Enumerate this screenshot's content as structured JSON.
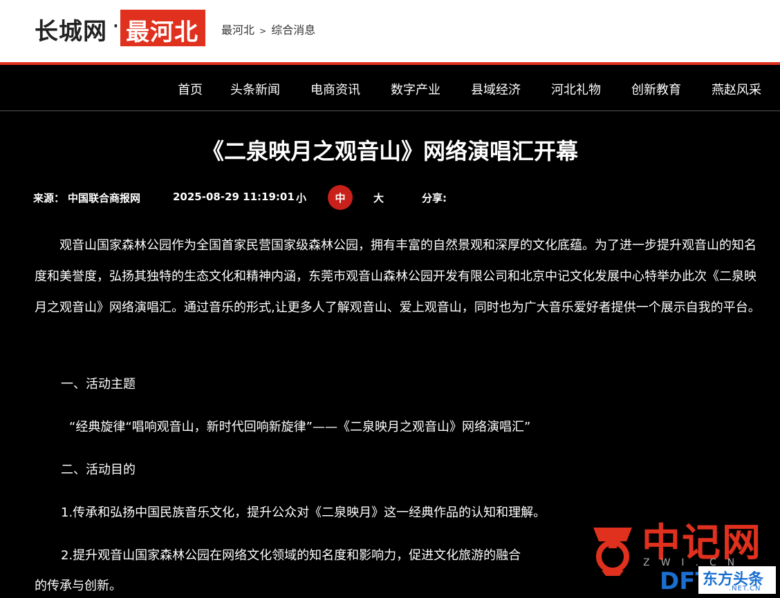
{
  "header": {
    "logo_main": "长城网",
    "logo_dot": "·",
    "logo_sub": "最河北",
    "breadcrumb": [
      "最河北",
      ">",
      "综合消息"
    ]
  },
  "nav": {
    "items": [
      "首页",
      "头条新闻",
      "电商资讯",
      "数字产业",
      "县域经济",
      "河北礼物",
      "创新教育",
      "燕赵风采"
    ]
  },
  "article": {
    "title": "《二泉映月之观音山》网络演唱汇开幕",
    "meta": {
      "source_label": "来源：",
      "source": "中国联合商报网",
      "datetime": "2025-08-29 11:19:01",
      "size_small": "小",
      "size_mid": "中",
      "size_large": "大",
      "share_label": "分享:"
    },
    "intro": "观音山国家森林公园作为全国首家民营国家级森林公园，拥有丰富的自然景观和深厚的文化底蕴。为了进一步提升观音山的知名度和美誉度，弘扬其独特的生态文化和精神内涵，东莞市观音山森林公园开发有限公司和北京中记文化发展中心特举办此次《二泉映月之观音山》网络演唱汇。通过音乐的形式,让更多人了解观音山、爱上观音山，同时也为广大音乐爱好者提供一个展示自我的平台。",
    "section1": "一、活动主题",
    "theme": "“经典旋律“唱响观音山，新时代回响新旋律”——《二泉映月之观音山》网络演唱汇”",
    "section2": "二、活动目的",
    "goal1": "1.传承和弘扬中国民族音乐文化，提升公众对《二泉映月》这一经典作品的认知和理解。",
    "goal2": "2.提升观音山国家森林公园在网络文化领域的知名度和影响力，促进文化旅游的融合",
    "goal2_tail": "的传承与创新。"
  },
  "watermark": {
    "name": "中记网",
    "sub": "ZWI.CN",
    "dftt": "DFTT",
    "dongfang": "东方头条",
    "net": ".NET.CN"
  },
  "colors": {
    "accent": "#e0301e",
    "background": "#000000",
    "dftt_blue": "#1a6fd0"
  }
}
